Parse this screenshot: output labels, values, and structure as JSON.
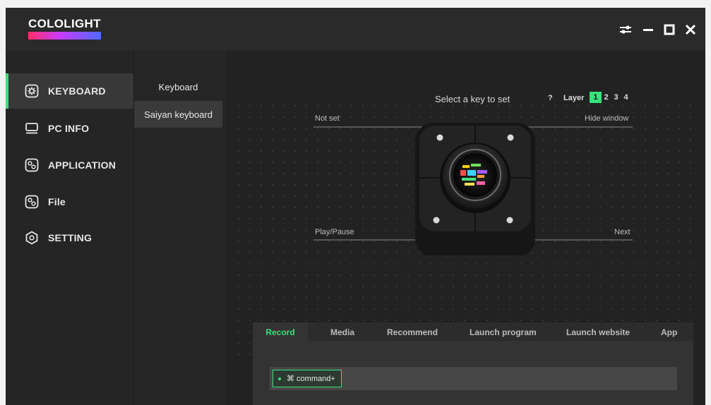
{
  "app": {
    "logo_text": "COLOLIGHT",
    "accent_color": "#36e27a"
  },
  "window_controls": [
    {
      "name": "settings-sliders-icon"
    },
    {
      "name": "minimize-icon"
    },
    {
      "name": "maximize-icon"
    },
    {
      "name": "close-icon"
    }
  ],
  "sidebar": {
    "items": [
      {
        "label": "KEYBOARD",
        "icon": "keyboard-gear-icon",
        "active": true
      },
      {
        "label": "PC INFO",
        "icon": "monitor-icon"
      },
      {
        "label": "APPLICATION",
        "icon": "application-icon"
      },
      {
        "label": "File",
        "icon": "file-icon"
      },
      {
        "label": "SETTING",
        "icon": "hexagon-settings-icon"
      }
    ]
  },
  "submenu": {
    "items": [
      {
        "label": "Keyboard"
      },
      {
        "label": "Saiyan keyboard",
        "active": true
      }
    ]
  },
  "main": {
    "select_title": "Select a key to set",
    "help": "?",
    "layer_label": "Layer",
    "layers": [
      "1",
      "2",
      "3",
      "4"
    ],
    "active_layer": "1",
    "keys": {
      "top_left": "Not set",
      "top_right": "Hide window",
      "bottom_left": "Play/Pause",
      "bottom_right": "Next"
    }
  },
  "panel": {
    "tabs": [
      "Record",
      "Media",
      "Recommend",
      "Launch program",
      "Launch website",
      "App"
    ],
    "active_tab": "Record",
    "record_value": "⌘ command+"
  }
}
